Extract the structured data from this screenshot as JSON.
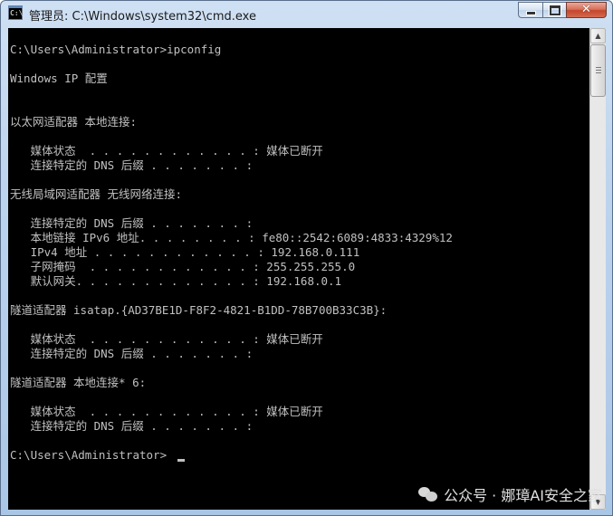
{
  "window": {
    "title": "管理员: C:\\Windows\\system32\\cmd.exe",
    "icon_name": "cmd-icon",
    "icon_text": "C:\\",
    "buttons": {
      "minimize": "minimize-icon",
      "maximize": "maximize-icon",
      "close": "✕"
    }
  },
  "console": {
    "lines": [
      "",
      "C:\\Users\\Administrator>ipconfig",
      "",
      "Windows IP 配置",
      "",
      "",
      "以太网适配器 本地连接:",
      "",
      "   媒体状态  . . . . . . . . . . . . : 媒体已断开",
      "   连接特定的 DNS 后缀 . . . . . . . :",
      "",
      "无线局域网适配器 无线网络连接:",
      "",
      "   连接特定的 DNS 后缀 . . . . . . . :",
      "   本地链接 IPv6 地址. . . . . . . . : fe80::2542:6089:4833:4329%12",
      "   IPv4 地址 . . . . . . . . . . . . : 192.168.0.111",
      "   子网掩码  . . . . . . . . . . . . : 255.255.255.0",
      "   默认网关. . . . . . . . . . . . . : 192.168.0.1",
      "",
      "隧道适配器 isatap.{AD37BE1D-F8F2-4821-B1DD-78B700B33C3B}:",
      "",
      "   媒体状态  . . . . . . . . . . . . : 媒体已断开",
      "   连接特定的 DNS 后缀 . . . . . . . :",
      "",
      "隧道适配器 本地连接* 6:",
      "",
      "   媒体状态  . . . . . . . . . . . . : 媒体已断开",
      "   连接特定的 DNS 后缀 . . . . . . . :",
      "",
      "C:\\Users\\Administrator>"
    ],
    "text_color": "#c0c0c0",
    "background": "#000000"
  },
  "scrollbar": {
    "up": "▲",
    "down": "▼"
  },
  "watermark": {
    "text": "公众号 · 娜璋AI安全之家"
  }
}
